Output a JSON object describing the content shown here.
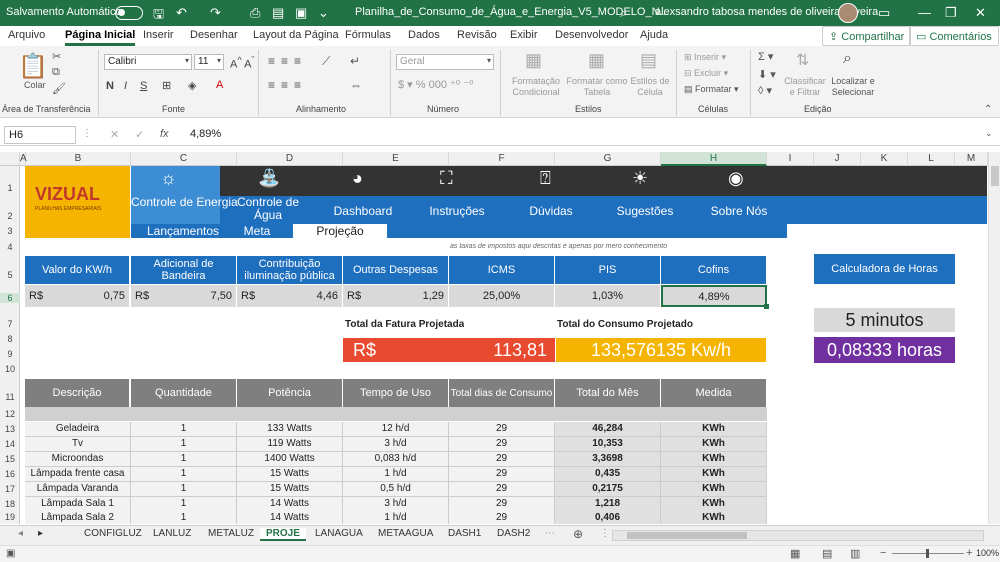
{
  "titlebar": {
    "autosave": "Salvamento Automático",
    "filename": "Planilha_de_Consumo_de_Água_e_Energia_V5_MODELO_N...",
    "user": "alexsandro tabosa mendes de oliveira oliveira"
  },
  "menu": {
    "tabs": [
      "Arquivo",
      "Página Inicial",
      "Inserir",
      "Desenhar",
      "Layout da Página",
      "Fórmulas",
      "Dados",
      "Revisão",
      "Exibir",
      "Desenvolvedor",
      "Ajuda"
    ],
    "share": "Compartilhar",
    "comments": "Comentários"
  },
  "ribbon": {
    "paste": "Colar",
    "font_name": "Calibri",
    "font_size": "11",
    "format_bold": "N",
    "format_italic": "I",
    "format_underline": "S",
    "number_format": "Geral",
    "cond_format": "Formatação Condicional",
    "format_table": "Formatar como Tabela",
    "cell_styles": "Estilos de Célula",
    "insert": "Inserir",
    "delete": "Excluir",
    "format": "Formatar",
    "sort_filter": "Classificar e Filtrar",
    "find_select": "Localizar e Selecionar",
    "groups": [
      "Área de Transferência",
      "Fonte",
      "Alinhamento",
      "Número",
      "Estilos",
      "Células",
      "Edição"
    ]
  },
  "formula_bar": {
    "cell_ref": "H6",
    "fx": "fx",
    "value": "4,89%"
  },
  "columns": [
    "A",
    "B",
    "C",
    "D",
    "E",
    "F",
    "G",
    "H",
    "I",
    "J",
    "K",
    "L",
    "M"
  ],
  "rows": [
    "1",
    "2",
    "3",
    "4",
    "5",
    "6",
    "7",
    "8",
    "9",
    "10",
    "11",
    "12",
    "13",
    "14",
    "15",
    "16",
    "17",
    "18",
    "19"
  ],
  "brand": {
    "logo": "VIZUAL",
    "tagline": "PLANILHAS EMPRESARIAIS"
  },
  "nav": [
    {
      "label": "Controle de Energia",
      "sub": "Lançamentos",
      "icon": "lightbulb-icon"
    },
    {
      "label": "Controle de Água",
      "sub": "Meta",
      "icon": "faucet-icon"
    },
    {
      "label": "Dashboard",
      "sub": "Projeção",
      "icon": "pie-chart-icon"
    },
    {
      "label": "Instruções",
      "icon": "presentation-icon"
    },
    {
      "label": "Dúvidas",
      "icon": "question-person-icon"
    },
    {
      "label": "Sugestões",
      "icon": "idea-icon"
    },
    {
      "label": "Sobre Nós",
      "icon": "shield-logo-icon"
    }
  ],
  "note": "as taxas de impostos aqui descritas é apenas por mero conhecimento",
  "rates": {
    "headers": [
      "Valor do KW/h",
      "Adicional de Bandeira",
      "Contribuição iluminação pública",
      "Outras Despesas",
      "ICMS",
      "PIS",
      "Cofins"
    ],
    "values": [
      {
        "prefix": "R$",
        "val": "0,75"
      },
      {
        "prefix": "R$",
        "val": "7,50"
      },
      {
        "prefix": "R$",
        "val": "4,46"
      },
      {
        "prefix": "R$",
        "val": "1,29"
      },
      {
        "prefix": "",
        "val": "25,00%"
      },
      {
        "prefix": "",
        "val": "1,03%"
      },
      {
        "prefix": "",
        "val": "4,89%"
      }
    ]
  },
  "calc": {
    "title": "Calculadora de Horas",
    "minutes": "5 minutos",
    "hours": "0,08333 horas"
  },
  "totals": {
    "fatura_label": "Total da Fatura Projetada",
    "fatura_prefix": "R$",
    "fatura_value": "113,81",
    "consumo_label": "Total do Consumo Projetado",
    "consumo_value": "133,576135 Kw/h"
  },
  "table": {
    "headers": [
      "Descrição",
      "Quantidade",
      "Potência",
      "Tempo de Uso",
      "Total dias de Consumo",
      "Total do Mês",
      "Medida"
    ],
    "rows": [
      [
        "Geladeira",
        "1",
        "133 Watts",
        "12 h/d",
        "29",
        "46,284",
        "KWh"
      ],
      [
        "Tv",
        "1",
        "119 Watts",
        "3 h/d",
        "29",
        "10,353",
        "KWh"
      ],
      [
        "Microondas",
        "1",
        "1400 Watts",
        "0,083 h/d",
        "29",
        "3,3698",
        "KWh"
      ],
      [
        "Lâmpada frente casa",
        "1",
        "15 Watts",
        "1 h/d",
        "29",
        "0,435",
        "KWh"
      ],
      [
        "Lâmpada Varanda",
        "1",
        "15 Watts",
        "0,5 h/d",
        "29",
        "0,2175",
        "KWh"
      ],
      [
        "Lâmpada Sala 1",
        "1",
        "14 Watts",
        "3 h/d",
        "29",
        "1,218",
        "KWh"
      ],
      [
        "Lâmpada Sala 2",
        "1",
        "14 Watts",
        "1 h/d",
        "29",
        "0,406",
        "KWh"
      ]
    ]
  },
  "sheets": [
    "CONFIGLUZ",
    "LANLUZ",
    "METALUZ",
    "PROJE",
    "LANAGUA",
    "METAAGUA",
    "DASH1",
    "DASH2"
  ],
  "active_sheet": "PROJE",
  "zoom": "100%"
}
